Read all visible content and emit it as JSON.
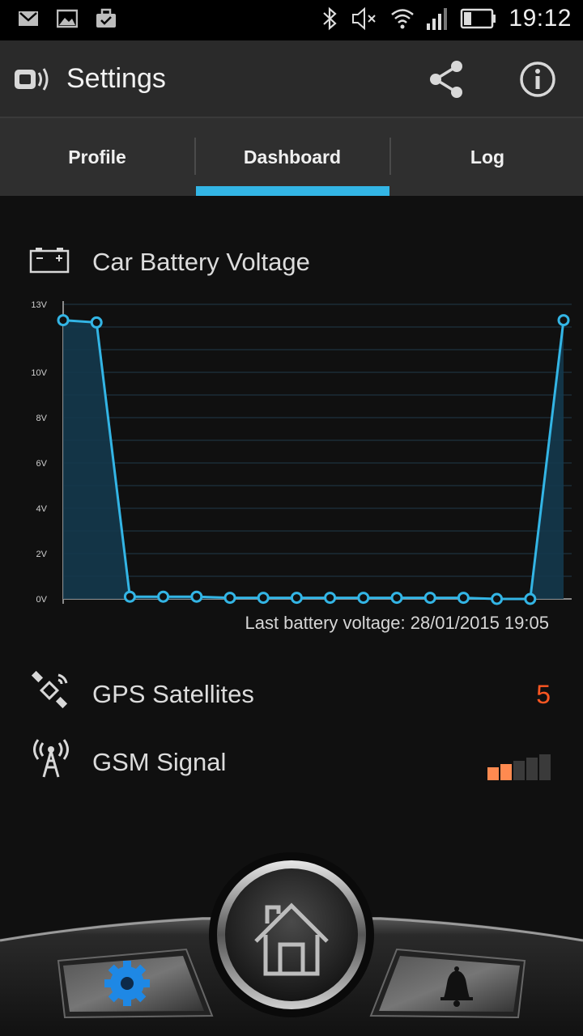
{
  "status_bar": {
    "time": "19:12",
    "left_icons": [
      "mail-icon",
      "image-icon",
      "briefcase-icon"
    ],
    "right_icons": [
      "bluetooth-icon",
      "mute-icon",
      "wifi-icon",
      "cell-signal-icon",
      "battery-icon"
    ]
  },
  "app_bar": {
    "title": "Settings",
    "actions": [
      "share-icon",
      "info-icon"
    ]
  },
  "tabs": [
    {
      "label": "Profile",
      "selected": false
    },
    {
      "label": "Dashboard",
      "selected": true
    },
    {
      "label": "Log",
      "selected": false
    }
  ],
  "accent_color": "#33b5e5",
  "battery": {
    "title": "Car Battery Voltage",
    "last_label": "Last battery voltage: 28/01/2015 19:05"
  },
  "chart_data": {
    "type": "area",
    "title": "",
    "xlabel": "",
    "ylabel": "",
    "ylim": [
      0,
      13
    ],
    "yticks": [
      "0V",
      "2V",
      "4V",
      "6V",
      "8V",
      "10V",
      "13V"
    ],
    "ytick_values": [
      0,
      2,
      4,
      6,
      8,
      10,
      13
    ],
    "grid": true,
    "series": [
      {
        "values": [
          12.3,
          12.2,
          0.1,
          0.1,
          0.1,
          0.05,
          0.05,
          0.05,
          0.05,
          0.05,
          0.05,
          0.05,
          0.05,
          0.0,
          0.0,
          12.3
        ]
      }
    ]
  },
  "gps": {
    "label": "GPS Satellites",
    "value": "5",
    "value_color": "#ff5722"
  },
  "gsm": {
    "label": "GSM Signal",
    "bars_active": 2,
    "bars_total": 5,
    "active_color": "#ff8a50"
  },
  "bottom_nav": {
    "items": [
      "settings-gear-icon",
      "home-icon",
      "bell-icon"
    ]
  }
}
